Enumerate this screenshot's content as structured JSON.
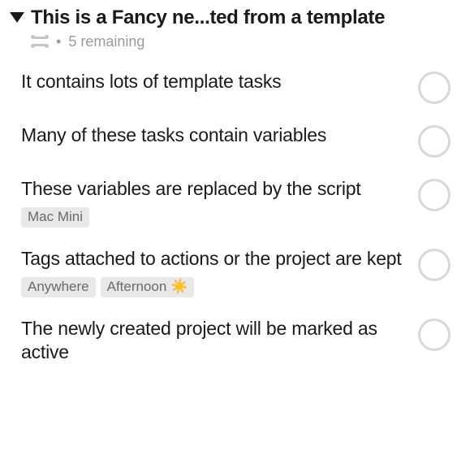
{
  "project": {
    "title": "This is a Fancy ne...ted from a template",
    "remaining_label": "5 remaining"
  },
  "tasks": [
    {
      "title": "It contains lots of template tasks",
      "tags": []
    },
    {
      "title": "Many of these tasks contain variables",
      "tags": []
    },
    {
      "title": "These variables are replaced by the script",
      "tags": [
        {
          "label": "Mac Mini"
        }
      ]
    },
    {
      "title": "Tags attached to actions or the project are kept",
      "tags": [
        {
          "label": "Anywhere"
        },
        {
          "label": "Afternoon ☀️"
        }
      ]
    },
    {
      "title": "The newly created project will be marked as active",
      "tags": []
    }
  ]
}
